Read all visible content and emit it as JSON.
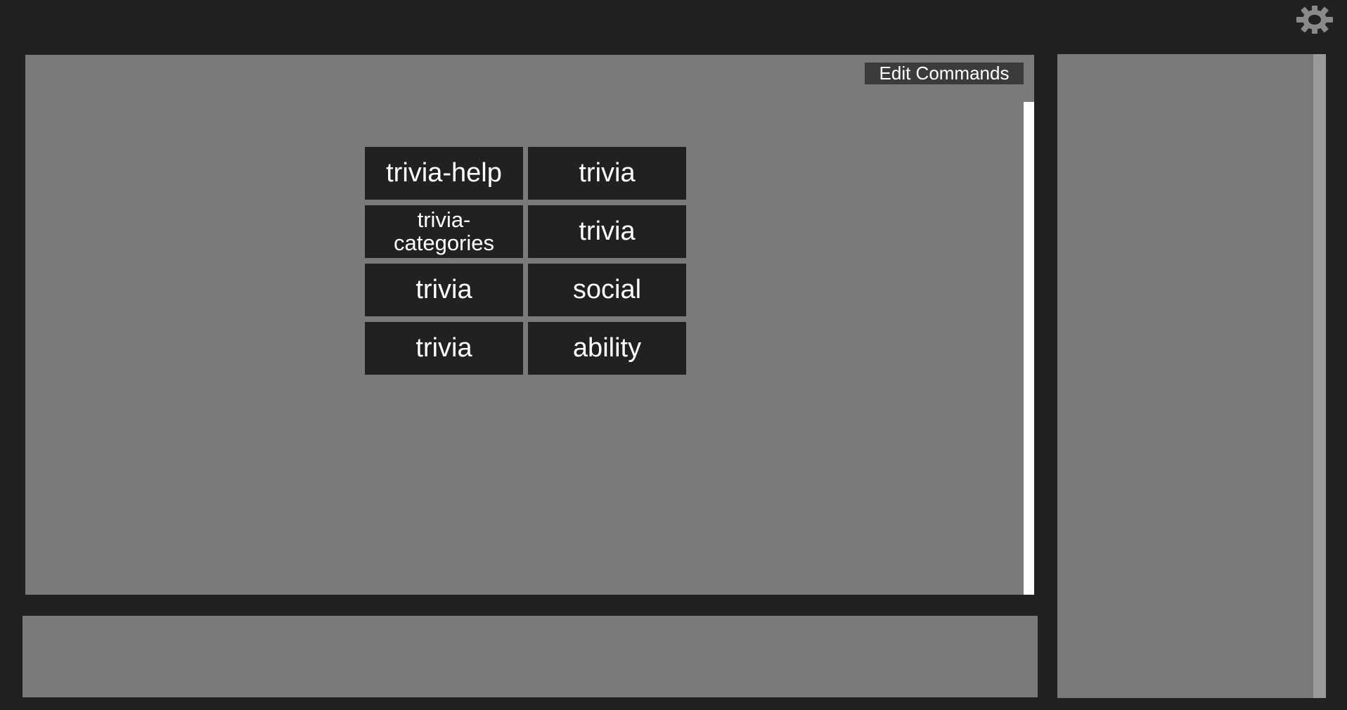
{
  "header": {
    "settings_icon": "gear-icon",
    "icon_color": "#8a8a8a"
  },
  "main": {
    "edit_commands_label": "Edit Commands",
    "commands": [
      {
        "label": "trivia-help"
      },
      {
        "label": "trivia"
      },
      {
        "label": "trivia-categories"
      },
      {
        "label": "trivia"
      },
      {
        "label": "trivia"
      },
      {
        "label": "social"
      },
      {
        "label": "trivia"
      },
      {
        "label": "ability"
      }
    ]
  },
  "colors": {
    "background": "#212121",
    "panel": "#7a7a7a",
    "button": "#212121",
    "edit_button": "#3b3b3b",
    "scrollbar": "#ffffff",
    "text": "#ffffff"
  }
}
